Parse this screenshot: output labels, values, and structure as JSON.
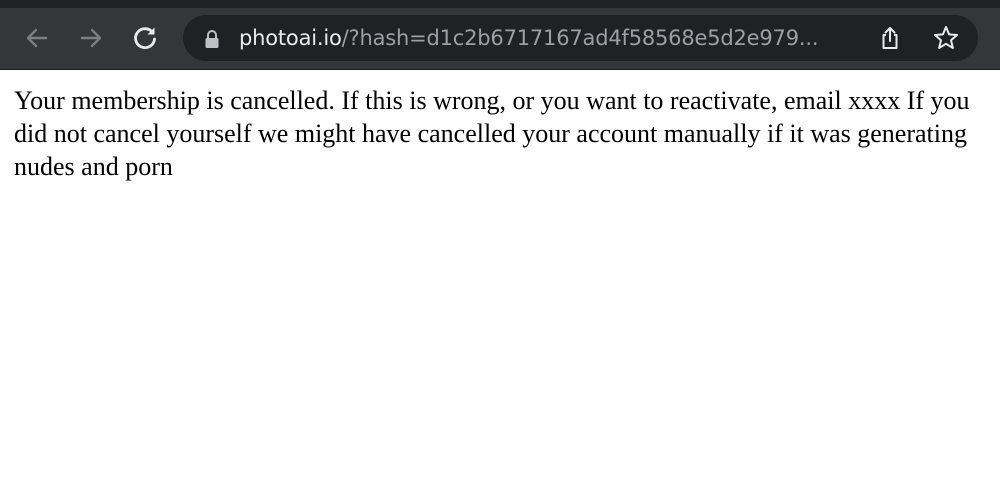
{
  "browser": {
    "url_host": "photoai.io",
    "url_path": "/?hash=d1c2b6717167ad4f58568e5d2e979...",
    "icons": {
      "back": "arrow-left-icon",
      "forward": "arrow-right-icon",
      "reload": "reload-icon",
      "lock": "lock-icon",
      "share": "share-icon",
      "bookmark": "star-icon"
    },
    "colors": {
      "toolbar_bg": "#35363a",
      "omnibox_bg": "#202124",
      "host_text": "#e8eaed",
      "path_text": "#9aa0a6"
    }
  },
  "page": {
    "message": "Your membership is cancelled. If this is wrong, or you want to reactivate, email xxxx If you did not cancel yourself we might have cancelled your account manually if it was generating nudes and porn"
  }
}
